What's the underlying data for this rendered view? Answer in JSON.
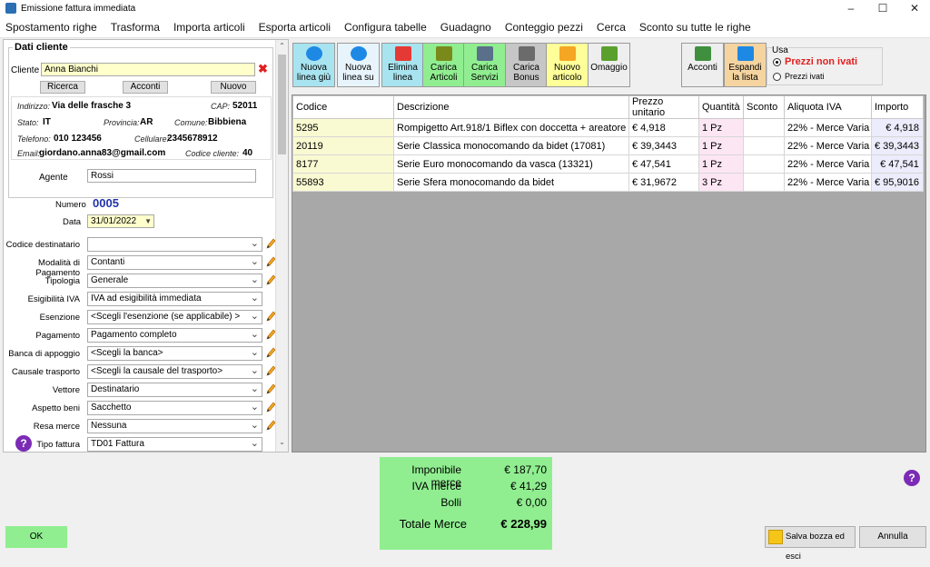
{
  "window": {
    "title": "Emissione fattura immediata"
  },
  "menu": [
    "Spostamento righe",
    "Trasforma",
    "Importa articoli",
    "Esporta articoli",
    "Configura tabelle",
    "Guadagno",
    "Conteggio pezzi",
    "Cerca",
    "Sconto su tutte le righe"
  ],
  "cliente": {
    "section_title": "Dati cliente",
    "label": "Cliente",
    "value": "Anna Bianchi",
    "ricerca": "Ricerca",
    "acconti": "Acconti",
    "nuovo": "Nuovo",
    "indirizzo_label": "Indirizzo:",
    "indirizzo": "Via delle frasche 3",
    "cap_label": "CAP:",
    "cap": "52011",
    "stato_label": "Stato:",
    "stato": "IT",
    "provincia_label": "Provincia:",
    "provincia": "AR",
    "comune_label": "Comune:",
    "comune": "Bibbiena",
    "telefono_label": "Telefono:",
    "telefono": "010 123456",
    "cellulare_label": "Cellulare:",
    "cellulare": "2345678912",
    "email_label": "Email:",
    "email": "giordano.anna83@gmail.com",
    "codice_cliente_label": "Codice cliente:",
    "codice_cliente": "40",
    "agente_label": "Agente",
    "agente": "Rossi"
  },
  "doc": {
    "numero_label": "Numero",
    "numero": "0005",
    "data_label": "Data",
    "data": "31/01/2022"
  },
  "fields": [
    {
      "label": "Codice destinatario",
      "value": "",
      "yellow": false,
      "pencil": true
    },
    {
      "label": "Modalità di Pagamento",
      "value": "Contanti",
      "yellow": true,
      "pencil": true
    },
    {
      "label": "Tipologia",
      "value": "Generale",
      "yellow": false,
      "pencil": true
    },
    {
      "label": "Esigibilità IVA",
      "value": "IVA ad esigibilità immediata",
      "yellow": false,
      "pencil": false
    },
    {
      "label": "Esenzione",
      "value": "<Scegli l'esenzione (se applicabile) >",
      "yellow": false,
      "pencil": true
    },
    {
      "label": "Pagamento",
      "value": "Pagamento completo",
      "yellow": true,
      "pencil": true
    },
    {
      "label": "Banca di appoggio",
      "value": "<Scegli la banca>",
      "yellow": false,
      "pencil": true
    },
    {
      "label": "Causale trasporto",
      "value": "<Scegli la causale del trasporto>",
      "yellow": false,
      "pencil": true
    },
    {
      "label": "Vettore",
      "value": "Destinatario",
      "yellow": false,
      "pencil": true
    },
    {
      "label": "Aspetto beni",
      "value": "Sacchetto",
      "yellow": false,
      "pencil": true
    },
    {
      "label": "Resa merce",
      "value": "Nessuna",
      "yellow": false,
      "pencil": true
    },
    {
      "label": "Tipo fattura",
      "value": "TD01 Fattura",
      "yellow": false,
      "pencil": false
    }
  ],
  "toolbar": [
    {
      "name": "nuova-linea-giu-button",
      "icon": "arrow-down-icon",
      "l1": "Nuova",
      "l2": "linea giù",
      "bg": "#a8e4f0",
      "ic": "#1e88e5"
    },
    {
      "name": "nuova-linea-su-button",
      "icon": "arrow-up-icon",
      "l1": "Nuova",
      "l2": "linea su",
      "bg": "#e8f4fc",
      "ic": "#1e88e5"
    },
    {
      "name": "elimina-linea-button",
      "icon": "minus-icon",
      "l1": "Elimina",
      "l2": "linea",
      "bg": "#a8e4f0",
      "ic": "#e53935"
    },
    {
      "name": "carica-articoli-button",
      "icon": "forklift-icon",
      "l1": "Carica",
      "l2": "Articoli",
      "bg": "#90ee90",
      "ic": "#7a8a1a"
    },
    {
      "name": "carica-servizi-button",
      "icon": "document-icon",
      "l1": "Carica",
      "l2": "Servizi",
      "bg": "#90ee90",
      "ic": "#5a6f8a"
    },
    {
      "name": "carica-bonus-button",
      "icon": "bonus-icon",
      "l1": "Carica",
      "l2": "Bonus",
      "bg": "#c6c6c6",
      "ic": "#6b6b6b"
    },
    {
      "name": "nuovo-articolo-button",
      "icon": "box-icon",
      "l1": "Nuovo",
      "l2": "articolo",
      "bg": "#ffff99",
      "ic": "#f5a623"
    },
    {
      "name": "omaggio-button",
      "icon": "gift-icon",
      "l1": "Omaggio",
      "l2": "",
      "bg": "#eeeeee",
      "ic": "#5aa02c"
    },
    {
      "name": "acconti-button",
      "icon": "money-icon",
      "l1": "Acconti",
      "l2": "",
      "bg": "#eeeeee",
      "ic": "#3f8f3f"
    },
    {
      "name": "espandi-lista-button",
      "icon": "expand-icon",
      "l1": "Espandi",
      "l2": "la lista",
      "bg": "#f5d4a0",
      "ic": "#1e88e5"
    }
  ],
  "usa": {
    "title": "Usa",
    "opt1": "Prezzi non ivati",
    "opt2": "Prezzi ivati"
  },
  "table": {
    "headers": [
      "Codice",
      "Descrizione",
      "Prezzo unitario",
      "Quantità",
      "Sconto",
      "Aliquota IVA",
      "Importo"
    ],
    "rows": [
      [
        "5295",
        "Rompigetto Art.918/1 Biflex con doccetta + areatore",
        "€ 4,918",
        "1 Pz",
        "",
        "22% - Merce Varia",
        "€ 4,918"
      ],
      [
        "20119",
        "Serie Classica monocomando da bidet (17081)",
        "€ 39,3443",
        "1 Pz",
        "",
        "22% - Merce Varia",
        "€ 39,3443"
      ],
      [
        "8177",
        "Serie Euro monocomando da vasca (13321)",
        "€ 47,541",
        "1 Pz",
        "",
        "22% - Merce Varia",
        "€ 47,541"
      ],
      [
        "55893",
        "Serie Sfera monocomando da bidet",
        "€ 31,9672",
        "3 Pz",
        "",
        "22% - Merce Varia",
        "€ 95,9016"
      ]
    ]
  },
  "totals": {
    "imponibile_label": "Imponibile merce",
    "imponibile": "€ 187,70",
    "iva_label": "IVA merce",
    "iva": "€ 41,29",
    "bolli_label": "Bolli",
    "bolli": "€ 0,00",
    "totale_label": "Totale Merce",
    "totale": "€ 228,99"
  },
  "buttons": {
    "ok": "OK",
    "salva": "Salva bozza ed esci",
    "annulla": "Annulla"
  }
}
